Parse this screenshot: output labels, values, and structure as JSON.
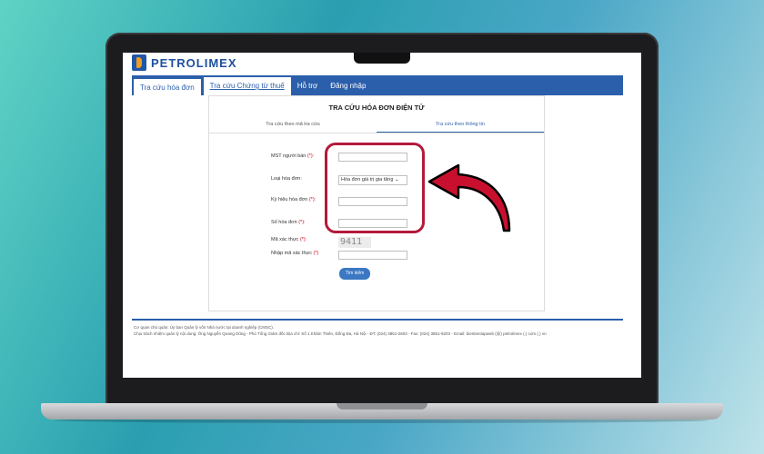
{
  "brand": {
    "logo_text": "PETROLIMEX"
  },
  "nav": {
    "tabs": [
      "Tra cứu hóa đơn",
      "Tra cứu Chứng từ thuế",
      "Hỗ trợ",
      "Đăng nhập"
    ]
  },
  "card": {
    "title": "TRA CỨU HÓA ĐƠN ĐIỆN TỬ",
    "sub_tabs": [
      "Tra cứu theo mã tra cứu",
      "Tra cứu theo thông tin"
    ]
  },
  "form": {
    "mst_label": "MST người bán",
    "invoice_type_label": "Loại hóa đơn:",
    "invoice_type_value": "Hóa đơn giá trị gia tăng",
    "symbol_label": "Ký hiệu hóa đơn",
    "number_label": "Số hóa đơn",
    "captcha_label": "Mã xác thực",
    "captcha_entry_label": "Nhập mã xác thực",
    "required_mark": "(*):",
    "required_mark_plain": "(*)",
    "captcha_text": "9411",
    "search_button": "Tìm kiếm"
  },
  "footer": {
    "line1": "Cơ quan chủ quản: Ủy ban Quản lý vốn Nhà nước tại doanh nghiệp (CMSC).",
    "line2": "Chịu trách nhiệm quản lý nội dung: Ông Nguyễn Quang Dũng - Phó Tổng Giám đốc Địa chỉ: Số 1 Khâm Thiên, Đống Đa, Hà Nội - ĐT: (024) 3851-2603 - Fax: (024) 3851-9203 - Email: bientientapweb (@) petrolimex (.) com (.) vn"
  },
  "colors": {
    "nav_blue": "#2b5fab",
    "highlight_red": "#b31a3a",
    "logo_orange": "#f29b1d"
  }
}
